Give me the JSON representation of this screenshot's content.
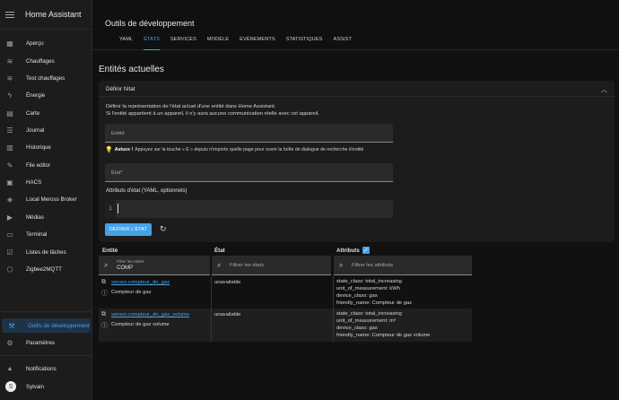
{
  "sidebar": {
    "title": "Home Assistant",
    "items": [
      {
        "label": "Aperçu",
        "icon": "view-dashboard-icon",
        "glyph": "▦"
      },
      {
        "label": "Chauffages",
        "icon": "radiator-icon",
        "glyph": "≋"
      },
      {
        "label": "Test chauffages",
        "icon": "radiator-icon",
        "glyph": "≋"
      },
      {
        "label": "Énergie",
        "icon": "lightning-bolt-icon",
        "glyph": "ϟ"
      },
      {
        "label": "Carte",
        "icon": "map-icon",
        "glyph": "▤"
      },
      {
        "label": "Journal",
        "icon": "format-list-icon",
        "glyph": "☰"
      },
      {
        "label": "Historique",
        "icon": "chart-box-icon",
        "glyph": "▥"
      },
      {
        "label": "File editor",
        "icon": "wrench-icon",
        "glyph": "✎"
      },
      {
        "label": "HACS",
        "icon": "hacs-icon",
        "glyph": "▣"
      },
      {
        "label": "Local Meross Broker",
        "icon": "meross-icon",
        "glyph": "◈"
      },
      {
        "label": "Médias",
        "icon": "play-box-icon",
        "glyph": "▶"
      },
      {
        "label": "Terminal",
        "icon": "console-icon",
        "glyph": "▭"
      },
      {
        "label": "Listes de tâches",
        "icon": "clipboard-list-icon",
        "glyph": "☑"
      },
      {
        "label": "Zigbee2MQTT",
        "icon": "zigbee-icon",
        "glyph": "⬡"
      }
    ],
    "dev_tools": {
      "label": "Outils de développement",
      "icon": "hammer-icon",
      "glyph": "⚒"
    },
    "settings": {
      "label": "Paramètres",
      "icon": "cog-icon",
      "glyph": "⚙"
    },
    "notifications": {
      "label": "Notifications",
      "icon": "bell-icon",
      "glyph": "🔔"
    },
    "user": {
      "label": "Sylvain",
      "initial": "S"
    }
  },
  "header": {
    "title": "Outils de développement",
    "tabs": [
      "YAML",
      "ÉTATS",
      "SERVICES",
      "MODÈLE",
      "ÉVÉNEMENTS",
      "STATISTIQUES",
      "ASSIST"
    ],
    "active_tab": "ÉTATS"
  },
  "main": {
    "page_title": "Entités actuelles",
    "set_state": {
      "title": "Définir l'état",
      "desc1": "Définir la représentation de l'état actuel d'une entité dans Home Assistant.",
      "desc2": "Si l'entité appartient à un appareil, il n'y aura aucune communication réelle avec cet appareil.",
      "entity_label": "Entité",
      "tip_bold": "Astuce !",
      "tip_text": "Appuyez sur la touche « E » depuis n'importe quelle page pour ouvrir la boîte de dialogue de recherche d'entité",
      "state_label": "État*",
      "yaml_label": "Attributs d'état (YAML, optionnels)",
      "yaml_line": "1",
      "button": "DÉFINIR L'ÉTAT"
    },
    "table": {
      "col_entity": "Entité",
      "col_state": "État",
      "col_attributes": "Attributs",
      "filter_entities_small": "Filtrer les entités",
      "filter_entities_value": "COMP",
      "filter_states": "Filtrer les états",
      "filter_attributes": "Filtrer les attributs",
      "rows": [
        {
          "entity_id": "sensor.compteur_de_gaz",
          "name": "Compteur de gaz",
          "state": "unavailable",
          "attributes": [
            "state_class: total_increasing",
            "unit_of_measurement: kWh",
            "device_class: gas",
            "friendly_name: Compteur de gaz"
          ]
        },
        {
          "entity_id": "sensor.compteur_de_gaz_volume",
          "name": "Compteur de gaz volume",
          "state": "unavailable",
          "attributes": [
            "state_class: total_increasing",
            "unit_of_measurement: m³",
            "device_class: gas",
            "friendly_name: Compteur de gaz volume"
          ]
        }
      ]
    }
  }
}
